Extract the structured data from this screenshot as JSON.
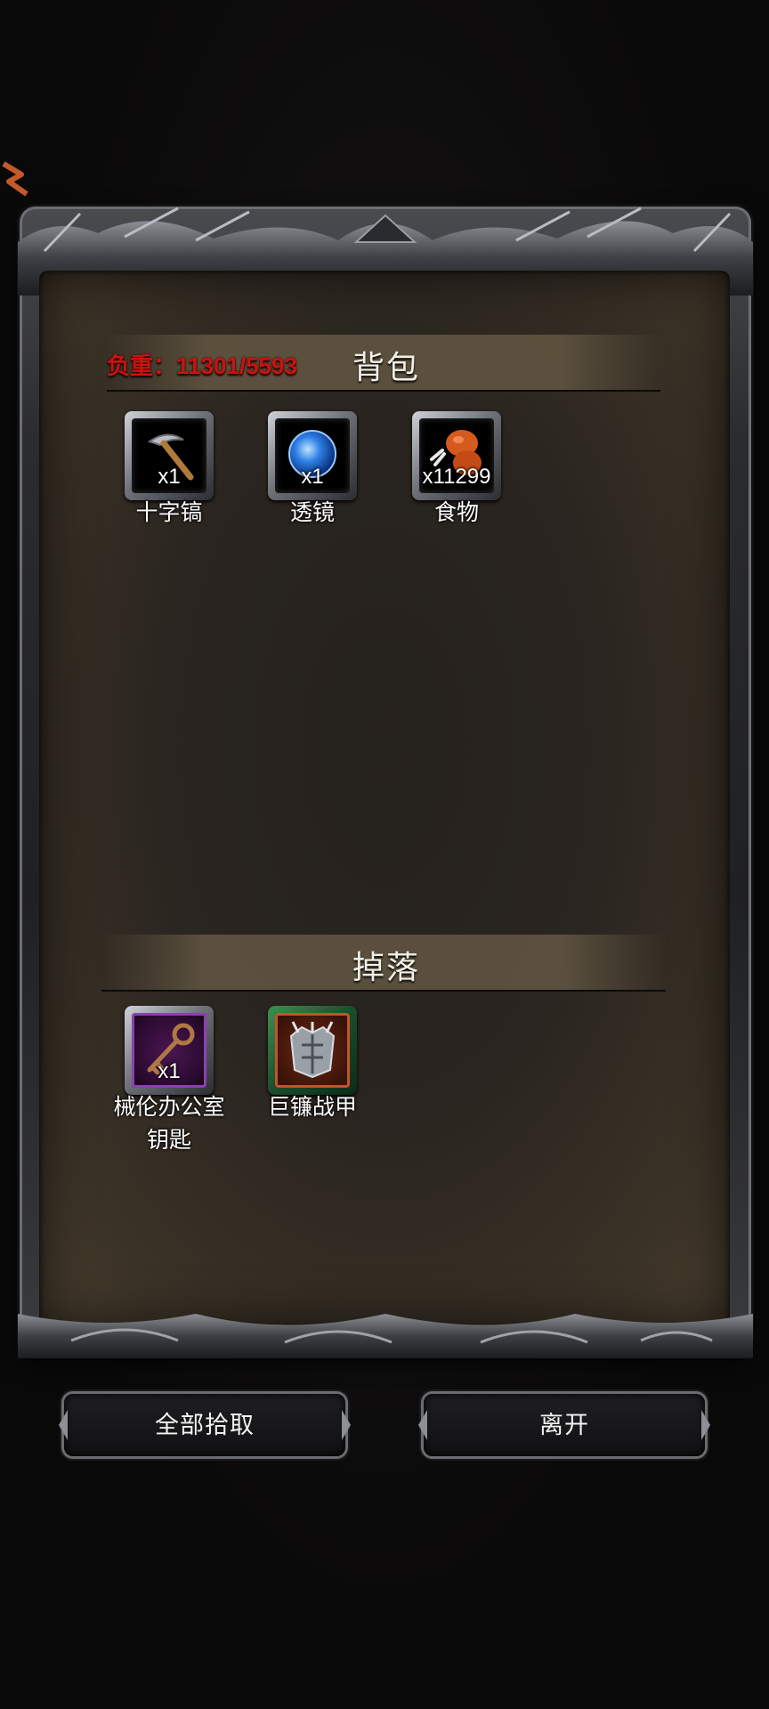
{
  "panel": {
    "weight_text": "负重：11301/5593",
    "bag_title": "背包",
    "drop_title": "掉落"
  },
  "bag_items": [
    {
      "name": "十字镐",
      "count": "x1",
      "icon": "pickaxe-icon"
    },
    {
      "name": "透镜",
      "count": "x1",
      "icon": "blue-orb-icon"
    },
    {
      "name": "食物",
      "count": "x11299",
      "icon": "meat-icon"
    }
  ],
  "drop_items": [
    {
      "name": "械伦办公室\n钥匙",
      "count": "x1",
      "icon": "key-icon"
    },
    {
      "name": "巨镰战甲",
      "count": "",
      "icon": "armor-icon"
    }
  ],
  "buttons": {
    "pick_all": "全部拾取",
    "leave": "离开"
  },
  "colors": {
    "weight": "#c8140f",
    "frame": "#6c6e73",
    "parchment": "#2a2520"
  }
}
